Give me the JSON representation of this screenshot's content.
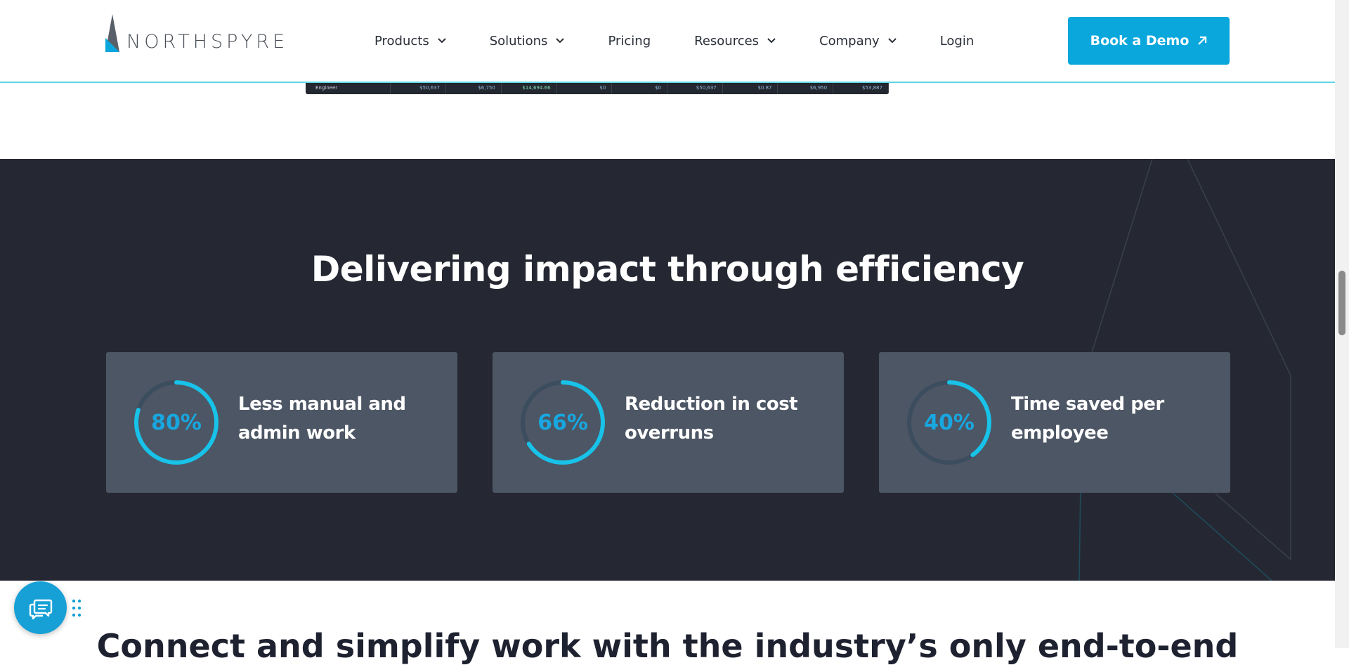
{
  "header": {
    "logo_text": "NORTHSPYRE",
    "nav": [
      {
        "label": "Products",
        "has_dropdown": true
      },
      {
        "label": "Solutions",
        "has_dropdown": true
      },
      {
        "label": "Pricing",
        "has_dropdown": false
      },
      {
        "label": "Resources",
        "has_dropdown": true
      },
      {
        "label": "Company",
        "has_dropdown": true
      },
      {
        "label": "Login",
        "has_dropdown": false
      }
    ],
    "demo_button": "Book a Demo"
  },
  "table_peek": {
    "row_label": "Engineer",
    "cells": [
      "$50,637",
      "$6,750",
      "$14,694.66",
      "$0",
      "$0",
      "$50,637",
      "$0.87",
      "$6,950",
      "$53,887"
    ]
  },
  "impact": {
    "title": "Delivering impact through efficiency",
    "stats": [
      {
        "value": "80%",
        "percent": 80,
        "label_line1": "Less manual and",
        "label_line2": "admin work"
      },
      {
        "value": "66%",
        "percent": 66,
        "label_line1": "Reduction in cost",
        "label_line2": "overruns"
      },
      {
        "value": "40%",
        "percent": 40,
        "label_line1": "Time saved per",
        "label_line2": "employee"
      }
    ]
  },
  "next_section": {
    "heading": "Connect and simplify work with the industry’s only end-to-end"
  },
  "colors": {
    "accent": "#0aa7dc",
    "dark_bg": "#252833",
    "card_bg": "#4d5664",
    "ring_track": "#3b4d5e",
    "ring_fill": "#18c2e8"
  },
  "icons": {
    "chat": "chat-bubbles-icon",
    "drag": "drag-dots-icon",
    "chevron": "chevron-down-icon",
    "arrow": "arrow-up-right-icon"
  }
}
